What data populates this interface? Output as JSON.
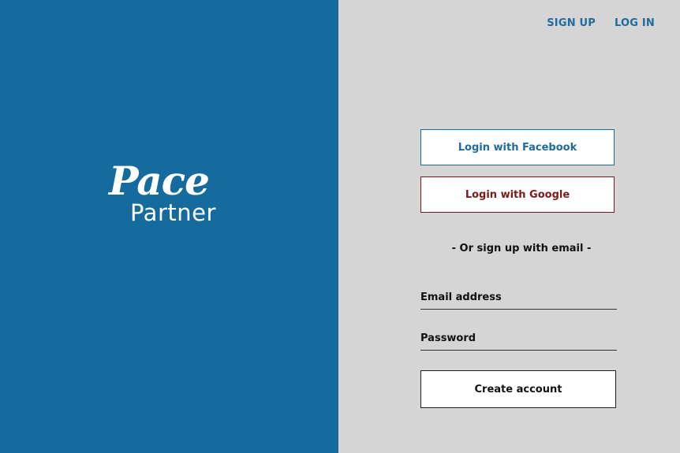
{
  "brand": {
    "script_text": "Pace",
    "word_text": "Partner"
  },
  "nav": {
    "signup_label": "SIGN UP",
    "login_label": "LOG IN"
  },
  "social": {
    "facebook_label": "Login with Facebook",
    "google_label": "Login with Google"
  },
  "divider": {
    "text": "- Or sign up with email -"
  },
  "form": {
    "email_placeholder": "Email address",
    "password_placeholder": "Password",
    "submit_label": "Create account"
  },
  "colors": {
    "brand_blue": "#156b9d",
    "panel_gray": "#d5d5d5",
    "link_blue": "#1f6b9c",
    "google_red": "#7d1a1a"
  }
}
